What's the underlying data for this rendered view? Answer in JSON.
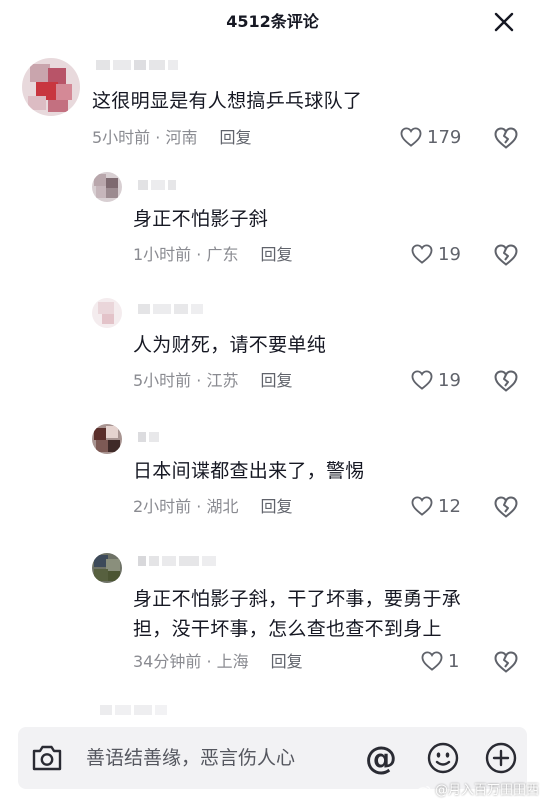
{
  "header": {
    "title": "4512条评论"
  },
  "comments": [
    {
      "text": "这很明显是有人想搞乒乓球队了",
      "time": "5小时前",
      "separator": " · ",
      "location": "河南",
      "reply_label": "回复",
      "likes": "179"
    },
    {
      "text": "身正不怕影子斜",
      "time": "1小时前",
      "separator": " · ",
      "location": "广东",
      "reply_label": "回复",
      "likes": "19"
    },
    {
      "text": "人为财死，请不要单纯",
      "time": "5小时前",
      "separator": " · ",
      "location": "江苏",
      "reply_label": "回复",
      "likes": "19"
    },
    {
      "text": "日本间谍都查出来了，警惕",
      "time": "2小时前",
      "separator": " · ",
      "location": "湖北",
      "reply_label": "回复",
      "likes": "12"
    },
    {
      "text": "身正不怕影子斜，干了坏事，要勇于承\n担，没干坏事，怎么查也查不到身上",
      "time": "34分钟前",
      "separator": " · ",
      "location": "上海",
      "reply_label": "回复",
      "likes": "1"
    }
  ],
  "input_bar": {
    "placeholder": "善语结善缘，恶言伤人心",
    "at_symbol": "@"
  },
  "watermark": {
    "text": "@月入百万田田西"
  },
  "colors": {
    "text_primary": "#161823",
    "text_secondary": "#8a8b91",
    "input_bg": "#f2f2f4"
  },
  "icons": {
    "close": "close-icon",
    "like": "heart-outline-icon",
    "dislike": "broken-heart-icon",
    "camera": "camera-icon",
    "emoji": "smiley-icon",
    "plus": "plus-circle-icon"
  }
}
